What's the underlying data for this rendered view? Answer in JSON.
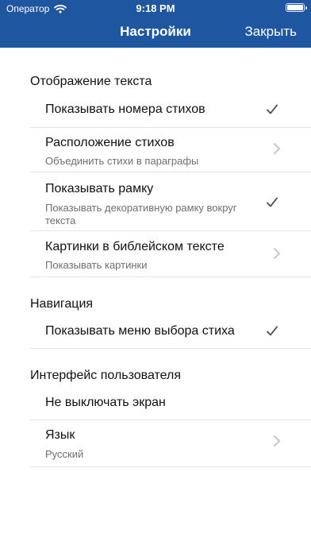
{
  "status_bar": {
    "carrier": "Оператор",
    "time": "9:18 PM"
  },
  "navigation": {
    "title": "Настройки",
    "close_label": "Закрыть"
  },
  "sections": {
    "text_display": {
      "header": "Отображение текста",
      "show_verse_numbers": "Показывать номера стихов",
      "verse_layout_title": "Расположение стихов",
      "verse_layout_value": "Объединить стихи в параграфы",
      "show_frame_title": "Показывать рамку",
      "show_frame_desc": "Показывать декоративную рамку вокруг текста",
      "pictures_title": "Картинки в библейском тексте",
      "pictures_value": "Показывать картинки"
    },
    "navigation": {
      "header": "Навигация",
      "show_verse_menu": "Показывать меню выбора стиха"
    },
    "user_interface": {
      "header": "Интерфейс пользователя",
      "keep_screen_on": "Не выключать экран",
      "language_title": "Язык",
      "language_value": "Русский"
    }
  },
  "colors": {
    "nav_bar": "#1f56a0",
    "check": "#4a4a4a",
    "chevron": "#c7c7cc",
    "subtitle": "#6f6f6f"
  }
}
